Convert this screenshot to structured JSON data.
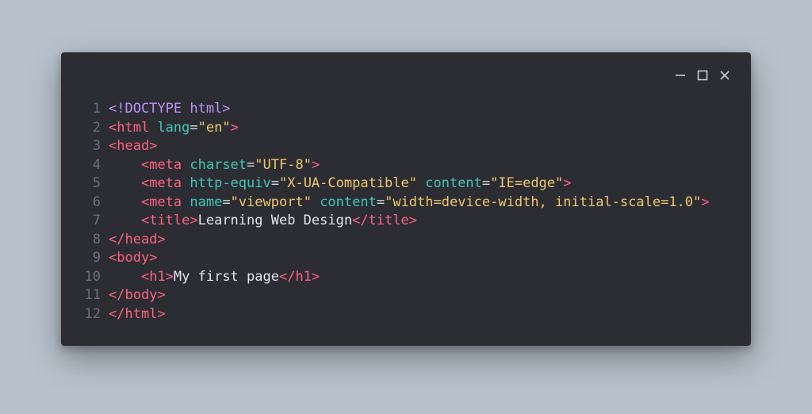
{
  "window": {
    "minimize_label": "minimize",
    "maximize_label": "maximize",
    "close_label": "close"
  },
  "code": {
    "lines": [
      {
        "n": "1",
        "tokens": [
          {
            "cls": "decl",
            "t": "<!DOCTYPE html>"
          }
        ]
      },
      {
        "n": "2",
        "tokens": [
          {
            "cls": "tag",
            "t": "<html "
          },
          {
            "cls": "attr",
            "t": "lang"
          },
          {
            "cls": "eq",
            "t": "="
          },
          {
            "cls": "str",
            "t": "\"en\""
          },
          {
            "cls": "tag",
            "t": ">"
          }
        ]
      },
      {
        "n": "3",
        "tokens": [
          {
            "cls": "tag",
            "t": "<head>"
          }
        ]
      },
      {
        "n": "4",
        "tokens": [
          {
            "cls": "txt",
            "t": "    "
          },
          {
            "cls": "tag",
            "t": "<meta "
          },
          {
            "cls": "attr",
            "t": "charset"
          },
          {
            "cls": "eq",
            "t": "="
          },
          {
            "cls": "str",
            "t": "\"UTF-8\""
          },
          {
            "cls": "tag",
            "t": ">"
          }
        ]
      },
      {
        "n": "5",
        "tokens": [
          {
            "cls": "txt",
            "t": "    "
          },
          {
            "cls": "tag",
            "t": "<meta "
          },
          {
            "cls": "attr",
            "t": "http-equiv"
          },
          {
            "cls": "eq",
            "t": "="
          },
          {
            "cls": "str",
            "t": "\"X-UA-Compatible\""
          },
          {
            "cls": "tag",
            "t": " "
          },
          {
            "cls": "attr",
            "t": "content"
          },
          {
            "cls": "eq",
            "t": "="
          },
          {
            "cls": "str",
            "t": "\"IE=edge\""
          },
          {
            "cls": "tag",
            "t": ">"
          }
        ]
      },
      {
        "n": "6",
        "tokens": [
          {
            "cls": "txt",
            "t": "    "
          },
          {
            "cls": "tag",
            "t": "<meta "
          },
          {
            "cls": "attr",
            "t": "name"
          },
          {
            "cls": "eq",
            "t": "="
          },
          {
            "cls": "str",
            "t": "\"viewport\""
          },
          {
            "cls": "tag",
            "t": " "
          },
          {
            "cls": "attr",
            "t": "content"
          },
          {
            "cls": "eq",
            "t": "="
          },
          {
            "cls": "str",
            "t": "\"width=device-width, initial-scale=1.0\""
          },
          {
            "cls": "tag",
            "t": ">"
          }
        ]
      },
      {
        "n": "7",
        "tokens": [
          {
            "cls": "txt",
            "t": "    "
          },
          {
            "cls": "tag",
            "t": "<title>"
          },
          {
            "cls": "txt",
            "t": "Learning Web Design"
          },
          {
            "cls": "tag",
            "t": "</title>"
          }
        ]
      },
      {
        "n": "8",
        "tokens": [
          {
            "cls": "tag",
            "t": "</head>"
          }
        ]
      },
      {
        "n": "9",
        "tokens": [
          {
            "cls": "tag",
            "t": "<body>"
          }
        ]
      },
      {
        "n": "10",
        "tokens": [
          {
            "cls": "txt",
            "t": "    "
          },
          {
            "cls": "tag",
            "t": "<h1>"
          },
          {
            "cls": "txt",
            "t": "My first page"
          },
          {
            "cls": "tag",
            "t": "</h1>"
          }
        ]
      },
      {
        "n": "11",
        "tokens": [
          {
            "cls": "tag",
            "t": "</body>"
          }
        ]
      },
      {
        "n": "12",
        "tokens": [
          {
            "cls": "tag",
            "t": "</html>"
          }
        ]
      }
    ]
  }
}
